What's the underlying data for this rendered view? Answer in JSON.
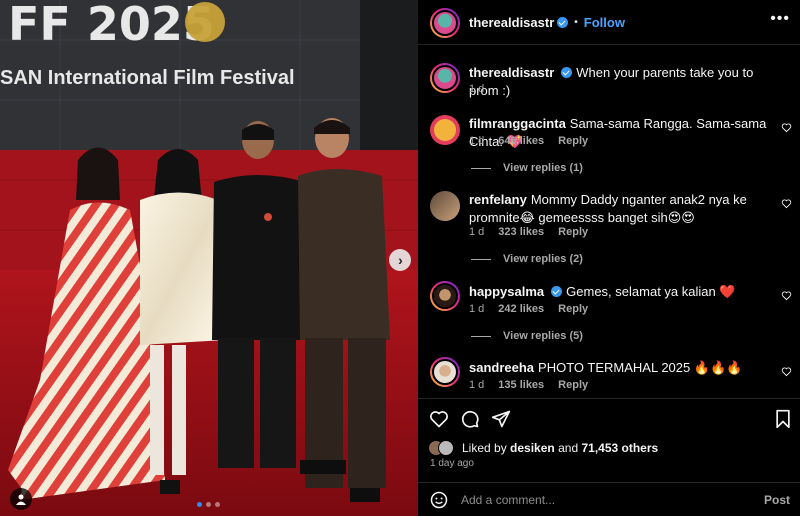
{
  "post": {
    "author": "therealdisastr",
    "follow_label": "Follow",
    "more_label": "•••",
    "caption": "When your parents take you to prom :)",
    "caption_time": "1 d",
    "image": {
      "banner_top": "FF 2025",
      "banner_bottom": "SAN International Film Festival",
      "next_label": "›",
      "slide_count": 3,
      "current_slide": 1
    }
  },
  "comments": [
    {
      "user": "filmranggacinta",
      "text": "Sama-sama Rangga. Sama-sama Cinta. 💖",
      "time": "1 d",
      "likes": "646 likes",
      "reply_label": "Reply",
      "view_replies": "View replies (1)"
    },
    {
      "user": "renfelany",
      "text": "Mommy Daddy nganter anak2 nya ke promnite😂 gemeessss banget sih😍😍",
      "time": "1 d",
      "likes": "323 likes",
      "reply_label": "Reply",
      "view_replies": "View replies (2)"
    },
    {
      "user": "happysalma",
      "text": "Gemes, selamat ya kalian ❤️",
      "time": "1 d",
      "likes": "242 likes",
      "reply_label": "Reply",
      "view_replies": "View replies (5)"
    },
    {
      "user": "sandreeha",
      "text": "PHOTO TERMAHAL 2025 🔥🔥🔥",
      "time": "1 d",
      "likes": "135 likes",
      "reply_label": "Reply"
    }
  ],
  "engagement": {
    "liked_by_prefix": "Liked by",
    "liked_by_user": "desiken",
    "and": "and",
    "others": "71,453 others",
    "posted_ago": "1 day ago"
  },
  "composer": {
    "placeholder": "Add a comment...",
    "post_label": "Post"
  },
  "colors": {
    "accent": "#4aa3ff",
    "verified": "#3897f0",
    "background": "#000000",
    "muted": "#a8a8a8"
  },
  "icons": [
    "heart-icon",
    "comment-icon",
    "share-icon",
    "bookmark-icon",
    "emoji-icon",
    "verified-icon",
    "more-icon",
    "user-tag-icon",
    "chevron-right-icon"
  ]
}
